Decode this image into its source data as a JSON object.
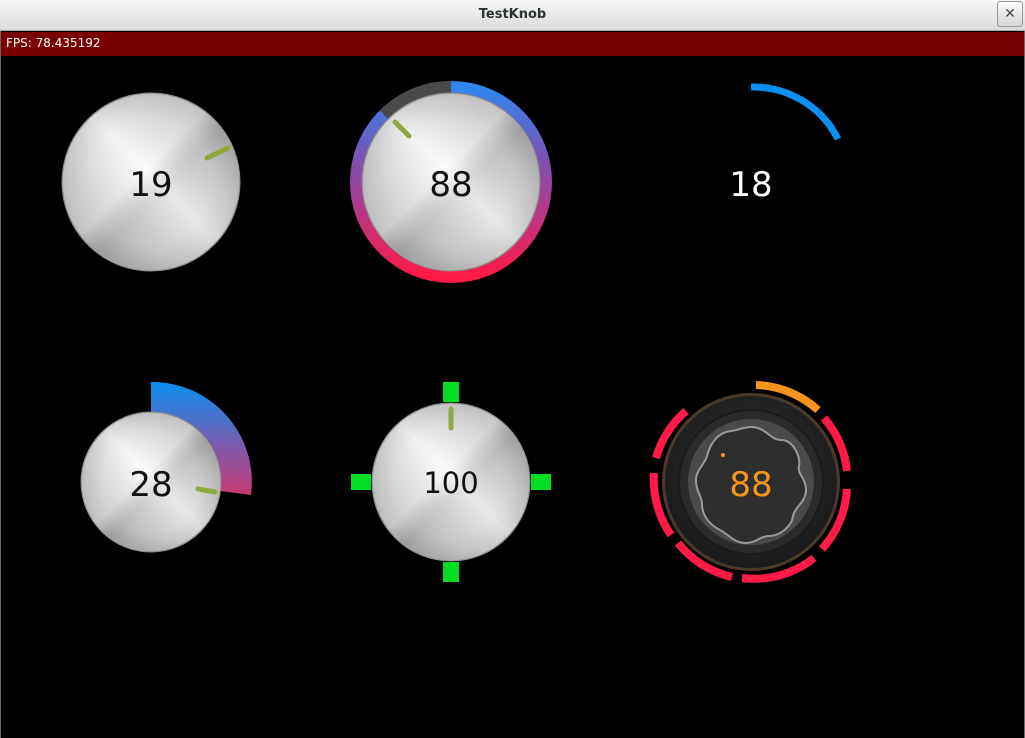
{
  "window": {
    "title": "TestKnob",
    "close_symbol": "✕"
  },
  "status": {
    "fps_label": "FPS: 78.435192"
  },
  "knobs": [
    {
      "id": "knob-1",
      "value": "19"
    },
    {
      "id": "knob-2",
      "value": "88"
    },
    {
      "id": "knob-3",
      "value": "18"
    },
    {
      "id": "knob-4",
      "value": "28"
    },
    {
      "id": "knob-5",
      "value": "100"
    },
    {
      "id": "knob-6",
      "value": "88"
    }
  ],
  "colors": {
    "fps_bar": "#7a0000",
    "arc_blue": "#0a8ff0",
    "arc_red": "#ff1a48",
    "marker_green": "#00dd22",
    "indicator_green": "#9ab84a",
    "accent_orange": "#f7941d"
  }
}
